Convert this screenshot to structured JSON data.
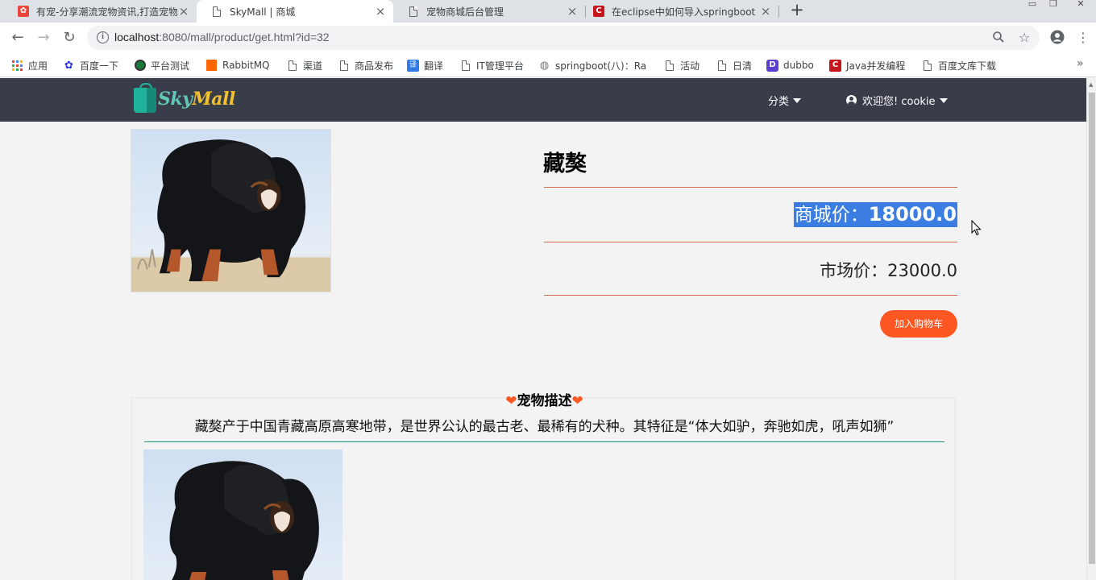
{
  "browser": {
    "tabs": [
      {
        "title": "有宠-分享潮流宠物资讯,打造宠物",
        "favicon": "red-paw",
        "active": false
      },
      {
        "title": "SkyMall | 商城",
        "favicon": "document",
        "active": true
      },
      {
        "title": "宠物商城后台管理",
        "favicon": "document",
        "active": false
      },
      {
        "title": "在eclipse中如何导入springboot",
        "favicon": "red-c",
        "active": false
      }
    ],
    "new_tab": "+",
    "url_host": "localhost",
    "url_path": ":8080/mall/product/get.html?id=32",
    "bookmarks": [
      {
        "label": "应用",
        "icon": "apps-grid"
      },
      {
        "label": "百度一下",
        "icon": "baidu-paw"
      },
      {
        "label": "平台测试",
        "icon": "green-circle"
      },
      {
        "label": "RabbitMQ",
        "icon": "rabbitmq-orange"
      },
      {
        "label": "渠道",
        "icon": "document"
      },
      {
        "label": "商品发布",
        "icon": "document"
      },
      {
        "label": "翻译",
        "icon": "blue-translate"
      },
      {
        "label": "IT管理平台",
        "icon": "document"
      },
      {
        "label": "springboot(八)：Ra",
        "icon": "gray-globe"
      },
      {
        "label": "活动",
        "icon": "document"
      },
      {
        "label": "日清",
        "icon": "document"
      },
      {
        "label": "dubbo",
        "icon": "purple-d"
      },
      {
        "label": "Java并发编程",
        "icon": "red-c"
      },
      {
        "label": "百度文库下载",
        "icon": "document"
      }
    ],
    "bookmarks_more": "»"
  },
  "site": {
    "logo_sky": "Sky",
    "logo_mall": "Mall",
    "nav_category": "分类",
    "nav_user": "欢迎您! cookie"
  },
  "product": {
    "name": "藏獒",
    "shop_price_label": "商城价：",
    "shop_price": "18000.0",
    "market_price_label": "市场价：",
    "market_price": "23000.0",
    "add_to_cart": "加入购物车"
  },
  "description": {
    "title": "宠物描述",
    "heart": "❤",
    "text": "藏獒产于中国青藏高原高寒地带，是世界公认的最古老、最稀有的犬种。其特征是“体大如驴，奔驰如虎，吼声如狮”"
  },
  "colors": {
    "navbar": "#393d49",
    "accent": "#ff5722",
    "divider": "#d9674f",
    "selection": "#3b7de0"
  }
}
